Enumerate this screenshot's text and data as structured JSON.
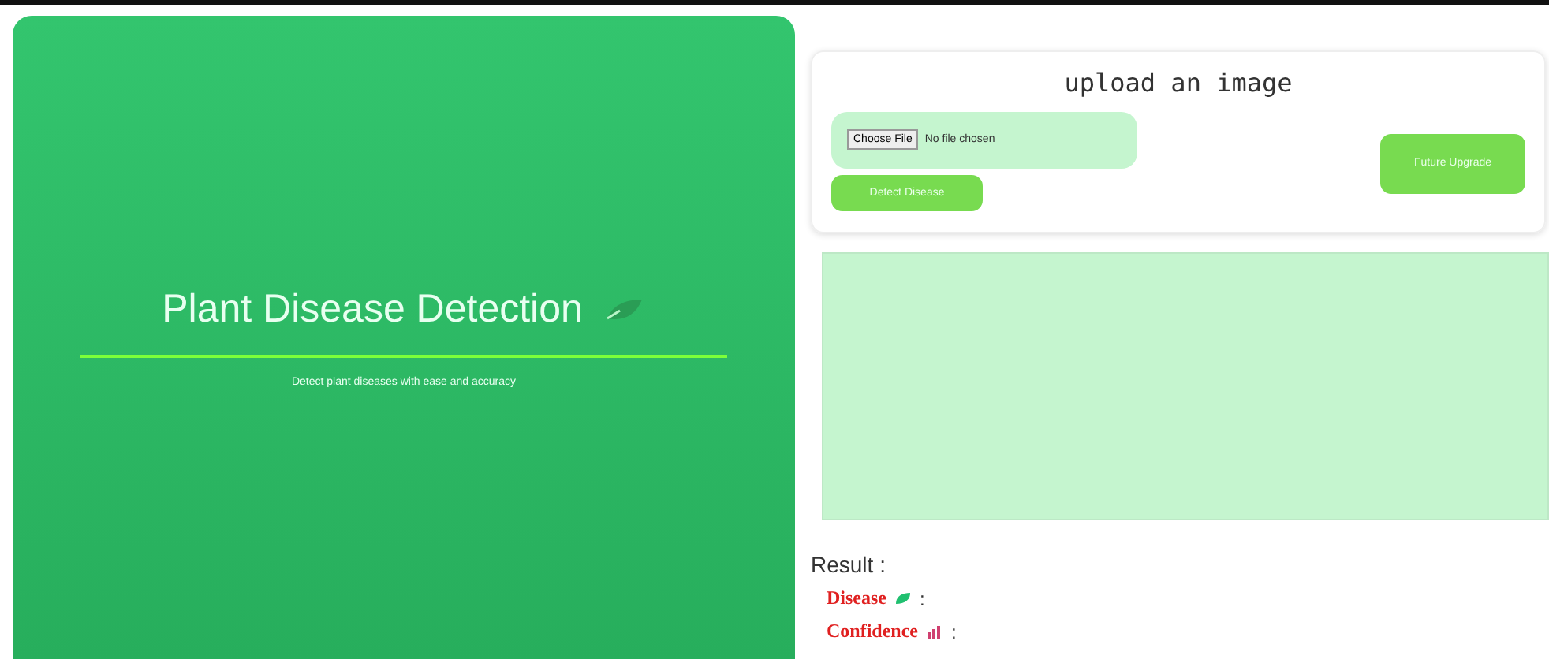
{
  "hero": {
    "title": "Plant Disease Detection",
    "subtitle": "Detect plant diseases with ease and accuracy"
  },
  "upload": {
    "heading": "upload an image",
    "file_button": "Choose File",
    "file_status": "No file chosen",
    "submit": "Detect Disease",
    "future": "Future Upgrade"
  },
  "result": {
    "label": "Result :",
    "fields": [
      {
        "name": "Disease",
        "kind": "leaf",
        "value": ":"
      },
      {
        "name": "Confidence",
        "kind": "chart",
        "value": ":"
      }
    ]
  }
}
